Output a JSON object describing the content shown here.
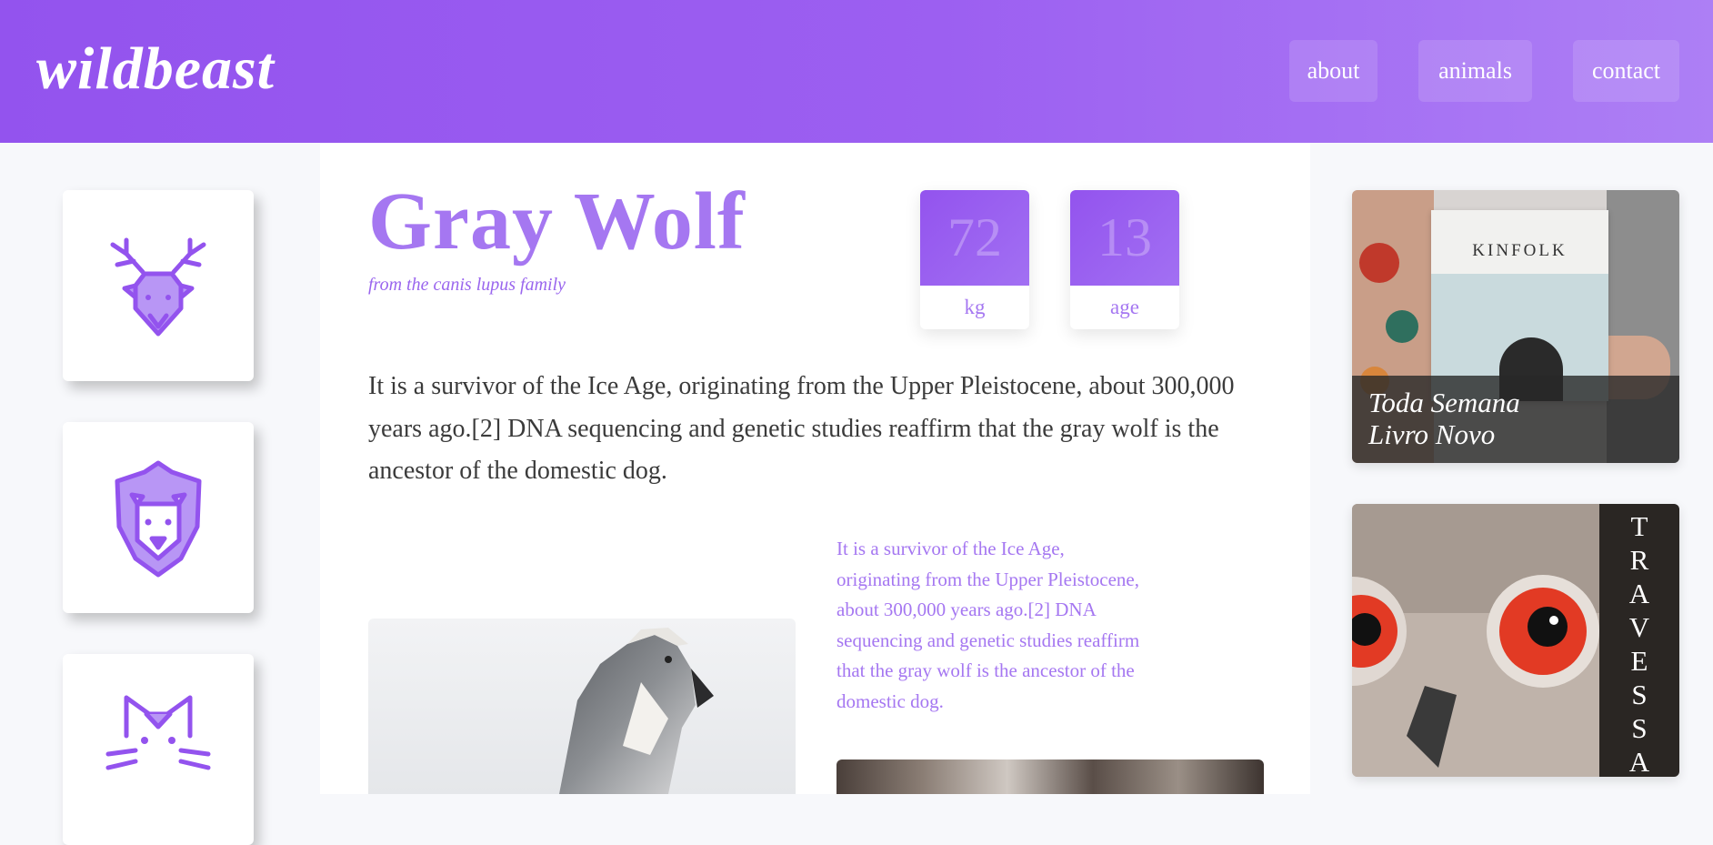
{
  "header": {
    "logo": "wildbeast",
    "nav": [
      {
        "label": "about"
      },
      {
        "label": "animals"
      },
      {
        "label": "contact"
      }
    ]
  },
  "sidebar": {
    "icons": [
      {
        "name": "deer-icon"
      },
      {
        "name": "lion-icon"
      },
      {
        "name": "cat-icon"
      }
    ]
  },
  "animal": {
    "name": "Gray Wolf",
    "subtitle": "from the canis lupus family",
    "stats": [
      {
        "value": "72",
        "label": "kg"
      },
      {
        "value": "13",
        "label": "age"
      }
    ],
    "description": "It is a survivor of the Ice Age, originating from the Upper Pleistocene, about 300,000 years ago.[2] DNA sequencing and genetic studies reaffirm that the gray wolf is the ancestor of the domestic dog.",
    "side_description": "It is a survivor of the Ice Age, originating from the Upper Pleistocene, about 300,000 years ago.[2] DNA sequencing and genetic studies reaffirm that the gray wolf is the ancestor of the domestic dog."
  },
  "promos": {
    "card1": {
      "book_title": "KINFOLK",
      "caption_line1": "Toda Semana",
      "caption_line2": "Livro Novo"
    },
    "card2": {
      "vertical_text": [
        "T",
        "R",
        "A",
        "V",
        "E",
        "S",
        "S",
        "A"
      ]
    }
  },
  "colors": {
    "accent": "#9353ee",
    "accent_light": "#a577f1"
  }
}
